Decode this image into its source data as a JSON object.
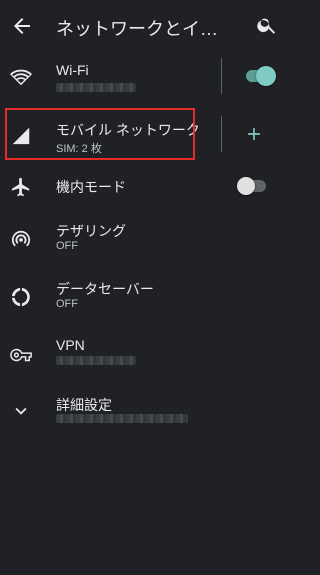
{
  "appbar": {
    "title": "ネットワークとインタ…",
    "back_icon": "arrow-back-icon",
    "search_icon": "search-icon"
  },
  "colors": {
    "background": "#202124",
    "accent": "#80cbc4",
    "highlight": "#e62b2b"
  },
  "settings": [
    {
      "id": "wifi",
      "icon": "wifi-icon",
      "label": "Wi-Fi",
      "subtitle": "",
      "subtitle_obscured": true,
      "control": "toggle",
      "toggle_on": true
    },
    {
      "id": "mobile-network",
      "icon": "signal-icon",
      "label": "モバイル ネットワーク",
      "subtitle": "SIM: 2 枚",
      "control": "add",
      "highlighted": true
    },
    {
      "id": "airplane-mode",
      "icon": "airplane-icon",
      "label": "機内モード",
      "subtitle": "",
      "control": "toggle",
      "toggle_on": false
    },
    {
      "id": "tethering",
      "icon": "hotspot-icon",
      "label": "テザリング",
      "subtitle": "OFF"
    },
    {
      "id": "data-saver",
      "icon": "data-saver-icon",
      "label": "データセーバー",
      "subtitle": "OFF"
    },
    {
      "id": "vpn",
      "icon": "vpn-key-icon",
      "label": "VPN",
      "subtitle": "",
      "subtitle_obscured": true
    },
    {
      "id": "advanced",
      "icon": "chevron-down-icon",
      "label": "詳細設定",
      "subtitle": "",
      "subtitle_obscured": true
    }
  ]
}
